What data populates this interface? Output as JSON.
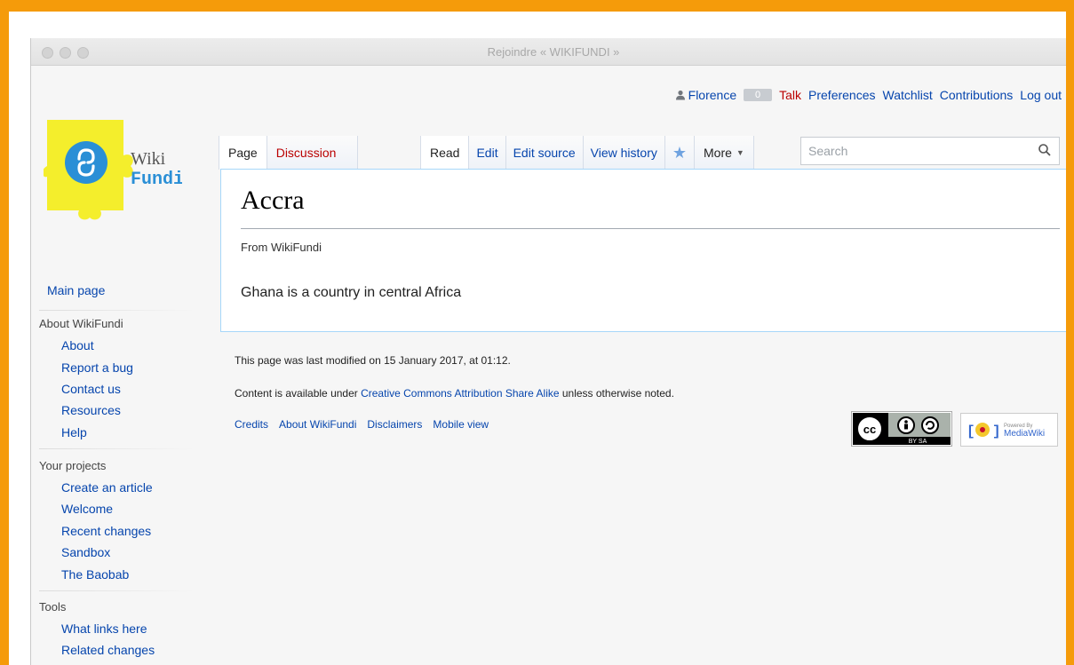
{
  "window": {
    "title": "Rejoindre « WIKIFUNDI »"
  },
  "logo": {
    "line1": "Wiki",
    "line2": "Fundi"
  },
  "personal": {
    "user": "Florence",
    "notifications": "0",
    "links": [
      "Talk",
      "Preferences",
      "Watchlist",
      "Contributions",
      "Log out"
    ]
  },
  "tabs": {
    "page": "Page",
    "discussion": "Discussion",
    "read": "Read",
    "edit": "Edit",
    "edit_source": "Edit source",
    "view_history": "View history",
    "more": "More"
  },
  "search": {
    "placeholder": "Search"
  },
  "article": {
    "title": "Accra",
    "subtitle": "From WikiFundi",
    "body": "Ghana is a country in central Africa"
  },
  "sidebar": {
    "main_page": "Main page",
    "sections": [
      {
        "heading": "About WikiFundi",
        "items": [
          "About",
          "Report a bug",
          "Contact us",
          "Resources",
          "Help"
        ]
      },
      {
        "heading": "Your projects",
        "items": [
          "Create an article",
          "Welcome",
          "Recent changes",
          "Sandbox",
          "The Baobab"
        ]
      },
      {
        "heading": "Tools",
        "items": [
          "What links here",
          "Related changes"
        ]
      }
    ]
  },
  "footer": {
    "last_modified": "This page was last modified on 15 January 2017, at 01:12.",
    "license_prefix": "Content is available under ",
    "license_link": "Creative Commons Attribution Share Alike",
    "license_suffix": " unless otherwise noted.",
    "links": [
      "Credits",
      "About WikiFundi",
      "Disclaimers",
      "Mobile view"
    ],
    "cc_label": "BY SA",
    "powered_by": "Powered By",
    "mediawiki": "MediaWiki"
  },
  "colors": {
    "frame": "#f59b0a",
    "link": "#0645ad",
    "redlink": "#ba0000",
    "logo_yellow": "#f4ee2c",
    "logo_blue": "#2a8fd6"
  }
}
